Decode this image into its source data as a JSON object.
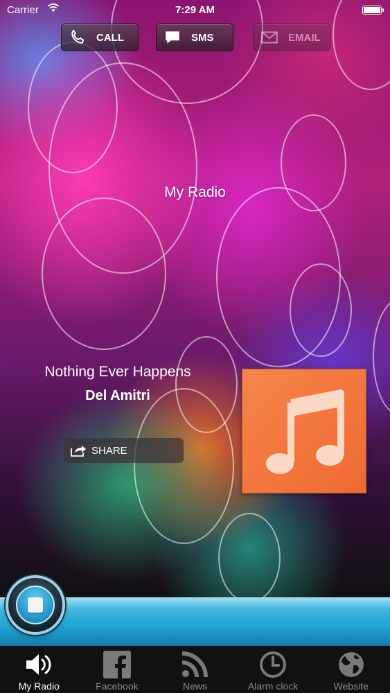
{
  "status_bar": {
    "carrier": "Carrier",
    "time": "7:29 AM"
  },
  "actions": {
    "call": "CALL",
    "sms": "SMS",
    "email": "EMAIL"
  },
  "station": {
    "name": "My Radio"
  },
  "now_playing": {
    "title": "Nothing Ever Happens",
    "artist": "Del Amitri",
    "share_label": "SHARE"
  },
  "tabs": [
    {
      "label": "My Radio",
      "icon": "speaker-icon"
    },
    {
      "label": "Facebook",
      "icon": "facebook-icon"
    },
    {
      "label": "News",
      "icon": "rss-icon"
    },
    {
      "label": "Alarm clock",
      "icon": "clock-icon"
    },
    {
      "label": "Website",
      "icon": "globe-icon"
    }
  ],
  "colors": {
    "player_bar": "#1b9bcc",
    "album_art": "#f07a3e",
    "tab_bar": "#111111"
  }
}
